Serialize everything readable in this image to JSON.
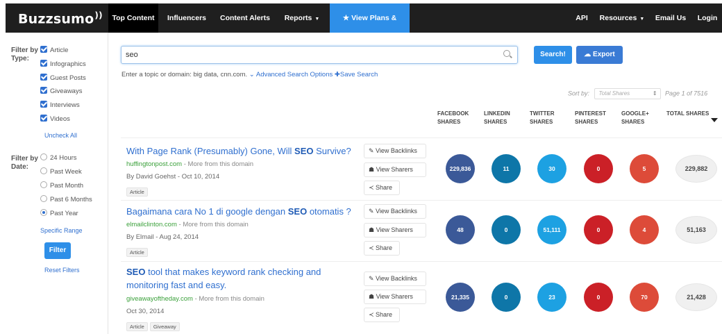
{
  "brand": {
    "logo_text": "Buzzsumo",
    "logo_mark": "))"
  },
  "nav": {
    "items": [
      {
        "label": "Top Content"
      },
      {
        "label": "Influencers"
      },
      {
        "label": "Content Alerts"
      },
      {
        "label": "Reports"
      },
      {
        "label": "★ View Plans & Pricing"
      },
      {
        "label": "API"
      },
      {
        "label": "Resources"
      },
      {
        "label": "Email Us"
      },
      {
        "label": "Login"
      }
    ]
  },
  "sidebar": {
    "type_label": "Filter by Type:",
    "types": [
      "Article",
      "Infographics",
      "Guest Posts",
      "Giveaways",
      "Interviews",
      "Videos"
    ],
    "uncheck_all": "Uncheck All",
    "date_label": "Filter by Date:",
    "dates": [
      "24 Hours",
      "Past Week",
      "Past Month",
      "Past 6 Months",
      "Past Year"
    ],
    "selected_date": "Past Year",
    "specific_range": "Specific Range",
    "filter_button": "Filter",
    "reset_filters": "Reset Filters"
  },
  "search": {
    "value": "seo",
    "search_button": "Search!",
    "export_button": "Export",
    "hint_text": "Enter a topic or domain: big data, cnn.com.",
    "advanced_link": "Advanced Search Options",
    "save_link": "Save Search"
  },
  "sorting": {
    "label": "Sort by:",
    "selected": "Total Shares",
    "page_info": "Page 1 of 7516"
  },
  "columns": {
    "facebook": "FACEBOOK SHARES",
    "linkedin": "LINKEDIN SHARES",
    "twitter": "TWITTER SHARES",
    "pinterest": "PINTEREST SHARES",
    "googleplus": "GOOGLE+ SHARES",
    "total": "TOTAL SHARES"
  },
  "actions": {
    "backlinks": "View Backlinks",
    "sharers": "View Sharers",
    "share": "Share"
  },
  "more_from_domain": "- More from this domain",
  "colors": {
    "facebook": "#3b5998",
    "linkedin": "#0e76a8",
    "twitter": "#1da1e2",
    "pinterest": "#cb2027",
    "googleplus": "#dd4b39"
  },
  "results": [
    {
      "title_pre": "With Page Rank (Presumably) Gone, Will ",
      "title_bold": "SEO",
      "title_post": " Survive?",
      "domain": "huffingtonpost.com",
      "author_line": "By David Goehst - Oct 10, 2014",
      "tags": [
        "Article"
      ],
      "facebook": "229,836",
      "linkedin": "11",
      "twitter": "30",
      "pinterest": "0",
      "googleplus": "5",
      "total": "229,882"
    },
    {
      "title_pre": "Bagaimana cara No 1 di google dengan ",
      "title_bold": "SEO",
      "title_post": " otomatis ?",
      "domain": "elmailclinton.com",
      "author_line": "By Elmail - Aug 24, 2014",
      "tags": [
        "Article"
      ],
      "facebook": "48",
      "linkedin": "0",
      "twitter": "51,111",
      "pinterest": "0",
      "googleplus": "4",
      "total": "51,163"
    },
    {
      "title_pre": "",
      "title_bold": "SEO",
      "title_post": " tool that makes keyword rank checking and monitoring fast and easy.",
      "domain": "giveawayoftheday.com",
      "author_line": "Oct 30, 2014",
      "tags": [
        "Article",
        "Giveaway"
      ],
      "facebook": "21,335",
      "linkedin": "0",
      "twitter": "23",
      "pinterest": "0",
      "googleplus": "70",
      "total": "21,428"
    }
  ]
}
